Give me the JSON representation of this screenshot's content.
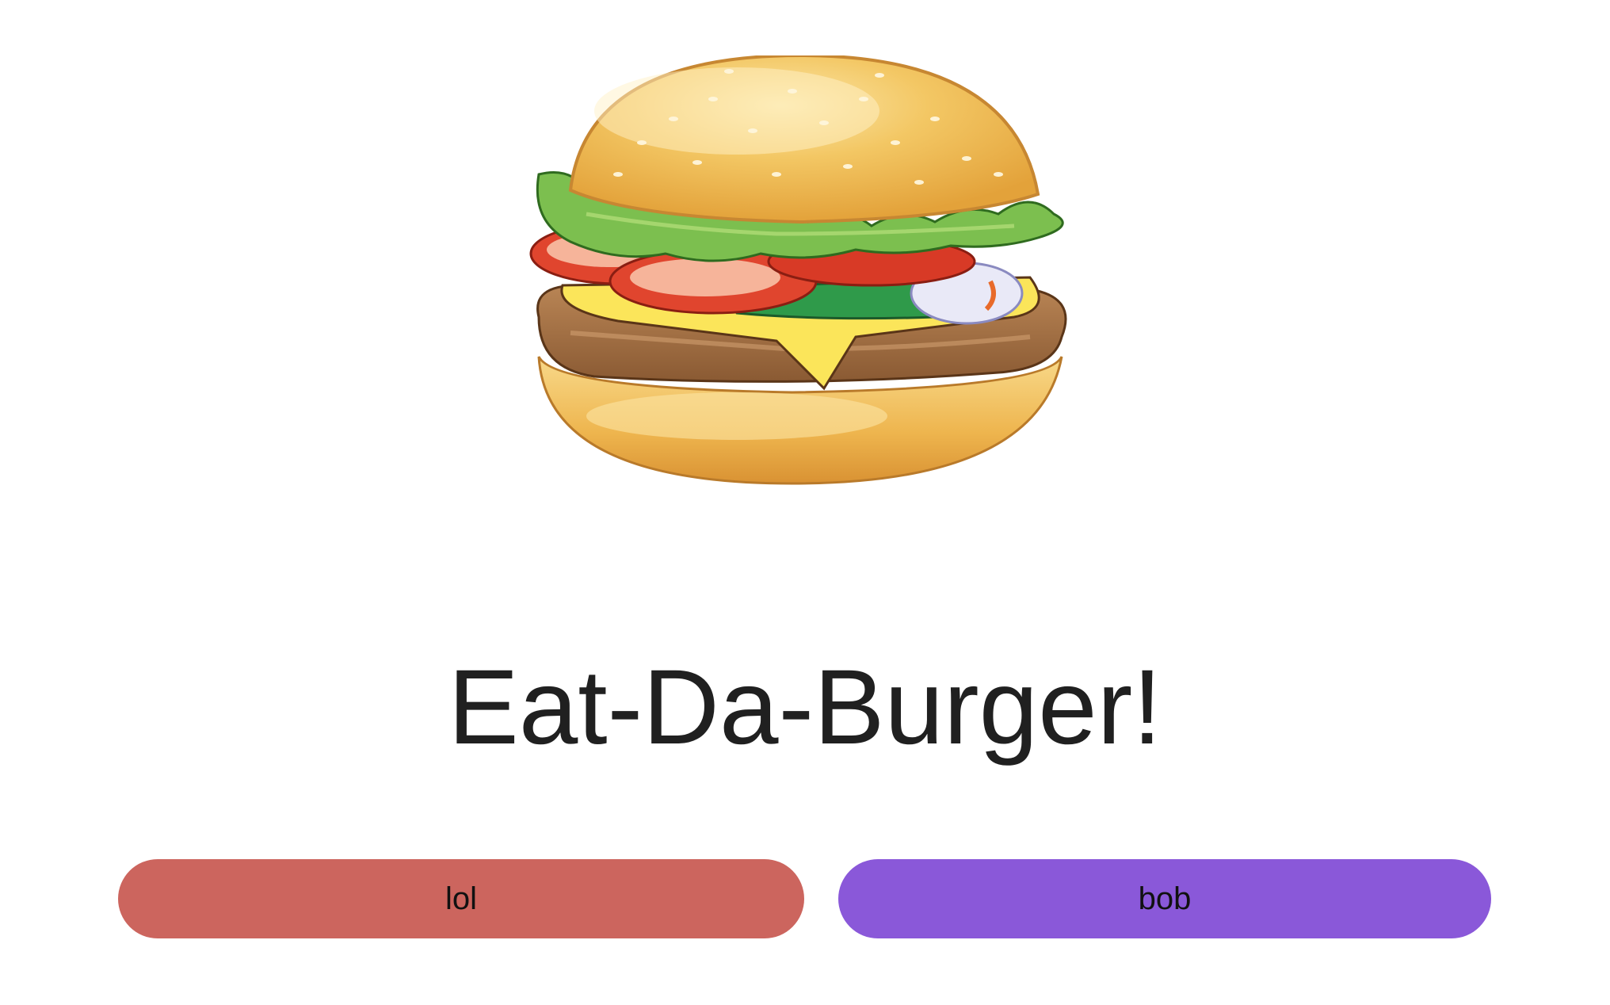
{
  "page": {
    "title": "Eat-Da-Burger!"
  },
  "image": {
    "icon": "burger-icon"
  },
  "buttons": [
    {
      "label": "lol",
      "color": "#cc655e"
    },
    {
      "label": "bob",
      "color": "#8a58d9"
    }
  ]
}
